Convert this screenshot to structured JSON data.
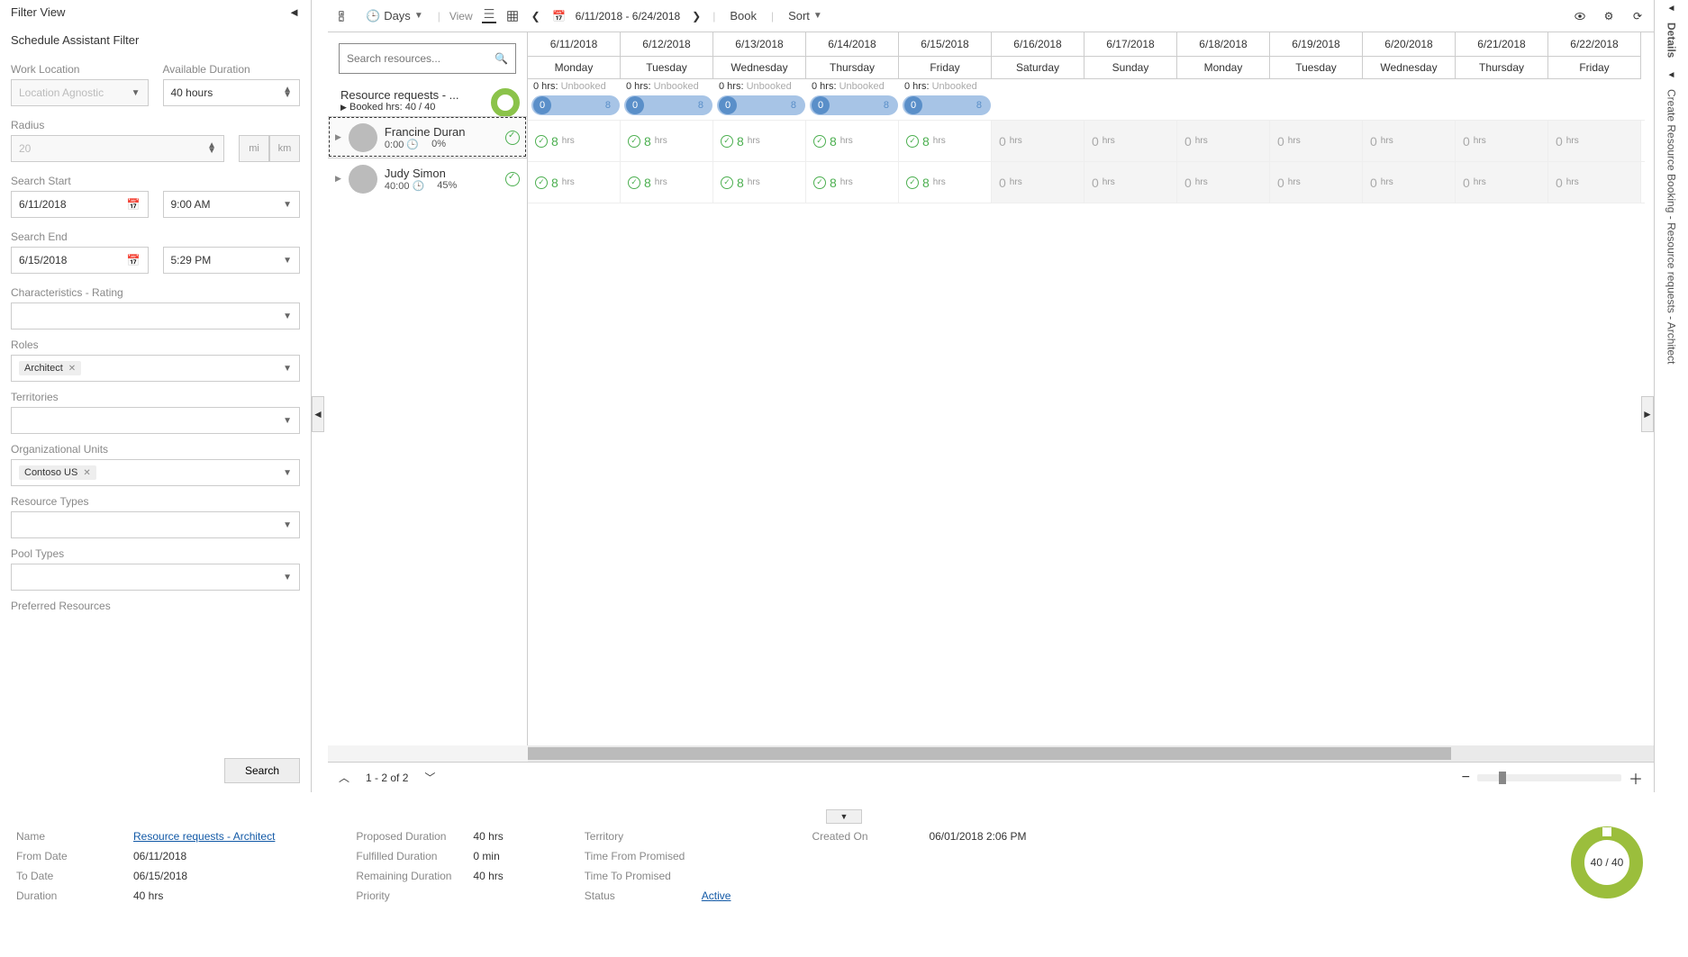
{
  "filter": {
    "title": "Filter View",
    "subtitle": "Schedule Assistant Filter",
    "work_location_label": "Work Location",
    "work_location_value": "Location Agnostic",
    "available_duration_label": "Available Duration",
    "available_duration_value": "40 hours",
    "radius_label": "Radius",
    "radius_value": "20",
    "unit_mi": "mi",
    "unit_km": "km",
    "search_start_label": "Search Start",
    "search_start_date": "6/11/2018",
    "search_start_time": "9:00 AM",
    "search_end_label": "Search End",
    "search_end_date": "6/15/2018",
    "search_end_time": "5:29 PM",
    "characteristics_label": "Characteristics - Rating",
    "roles_label": "Roles",
    "roles_chip": "Architect",
    "territories_label": "Territories",
    "org_units_label": "Organizational Units",
    "org_units_chip": "Contoso US",
    "resource_types_label": "Resource Types",
    "pool_types_label": "Pool Types",
    "preferred_resources_label": "Preferred Resources",
    "search_btn": "Search"
  },
  "toolbar": {
    "days": "Days",
    "view": "View",
    "range": "6/11/2018 - 6/24/2018",
    "book": "Book",
    "sort": "Sort"
  },
  "resource_search_placeholder": "Search resources...",
  "req_summary": {
    "title": "Resource requests - ...",
    "booked": "Booked hrs: 40 / 40"
  },
  "resources": [
    {
      "name": "Francine Duran",
      "time": "0:00",
      "pct": "0%"
    },
    {
      "name": "Judy Simon",
      "time": "40:00",
      "pct": "45%"
    }
  ],
  "dates": [
    {
      "d": "6/11/2018",
      "dow": "Monday",
      "weekend": false
    },
    {
      "d": "6/12/2018",
      "dow": "Tuesday",
      "weekend": false
    },
    {
      "d": "6/13/2018",
      "dow": "Wednesday",
      "weekend": false
    },
    {
      "d": "6/14/2018",
      "dow": "Thursday",
      "weekend": false
    },
    {
      "d": "6/15/2018",
      "dow": "Friday",
      "weekend": false
    },
    {
      "d": "6/16/2018",
      "dow": "Saturday",
      "weekend": true
    },
    {
      "d": "6/17/2018",
      "dow": "Sunday",
      "weekend": true
    },
    {
      "d": "6/18/2018",
      "dow": "Monday",
      "weekend": true
    },
    {
      "d": "6/19/2018",
      "dow": "Tuesday",
      "weekend": true
    },
    {
      "d": "6/20/2018",
      "dow": "Wednesday",
      "weekend": true
    },
    {
      "d": "6/21/2018",
      "dow": "Thursday",
      "weekend": true
    },
    {
      "d": "6/22/2018",
      "dow": "Friday",
      "weekend": true
    }
  ],
  "unbooked_label": "Unbooked",
  "unbooked_hours": "0 hrs:",
  "pill_left": "0",
  "pill_right": "8",
  "hrs_label": "hrs",
  "slot": {
    "work_val": "8",
    "off_val": "0"
  },
  "pager": {
    "range": "1 - 2 of 2"
  },
  "right_rail": {
    "vertical": "Create Resource Booking - Resource requests - Architect",
    "details_tab": "Details"
  },
  "details": {
    "name_label": "Name",
    "name_link": "Resource requests - Architect",
    "from_label": "From Date",
    "from_val": "06/11/2018",
    "to_label": "To Date",
    "to_val": "06/15/2018",
    "duration_label": "Duration",
    "duration_val": "40 hrs",
    "proposed_label": "Proposed Duration",
    "proposed_val": "40 hrs",
    "fulfilled_label": "Fulfilled Duration",
    "fulfilled_val": "0 min",
    "remaining_label": "Remaining Duration",
    "remaining_val": "40 hrs",
    "priority_label": "Priority",
    "territory_label": "Territory",
    "tfrom_label": "Time From Promised",
    "tto_label": "Time To Promised",
    "status_label": "Status",
    "status_val": "Active",
    "created_label": "Created On",
    "created_val": "06/01/2018 2:06 PM",
    "donut": "40 / 40"
  }
}
